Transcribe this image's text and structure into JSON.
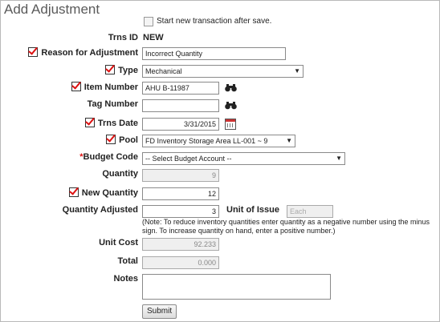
{
  "title": "Add Adjustment",
  "start_new_label": "Start new transaction after save.",
  "fields": {
    "trns_id": {
      "label": "Trns ID",
      "value": "NEW"
    },
    "reason": {
      "label": "Reason for Adjustment",
      "value": "Incorrect Quantity"
    },
    "type": {
      "label": "Type",
      "value": "Mechanical"
    },
    "item_number": {
      "label": "Item Number",
      "value": "AHU B-11987"
    },
    "tag_number": {
      "label": "Tag Number",
      "value": ""
    },
    "trns_date": {
      "label": "Trns Date",
      "value": "3/31/2015"
    },
    "pool": {
      "label": "Pool",
      "value": "FD Inventory Storage Area LL-001 ~ 9"
    },
    "budget_code": {
      "label": "Budget Code",
      "value": "-- Select Budget Account --"
    },
    "quantity": {
      "label": "Quantity",
      "value": "9"
    },
    "new_quantity": {
      "label": "New Quantity",
      "value": "12"
    },
    "quantity_adjusted": {
      "label": "Quantity Adjusted",
      "value": "3"
    },
    "unit_of_issue": {
      "label": "Unit of Issue",
      "placeholder": "Each"
    },
    "unit_cost": {
      "label": "Unit Cost",
      "value": "92.233"
    },
    "total": {
      "label": "Total",
      "value": "0.000"
    },
    "notes": {
      "label": "Notes",
      "value": ""
    }
  },
  "note_text": "(Note: To reduce inventory quantities enter quantity as a negative number using the minus sign. To increase quantity on hand, enter a positive number.)",
  "submit_label": "Submit"
}
